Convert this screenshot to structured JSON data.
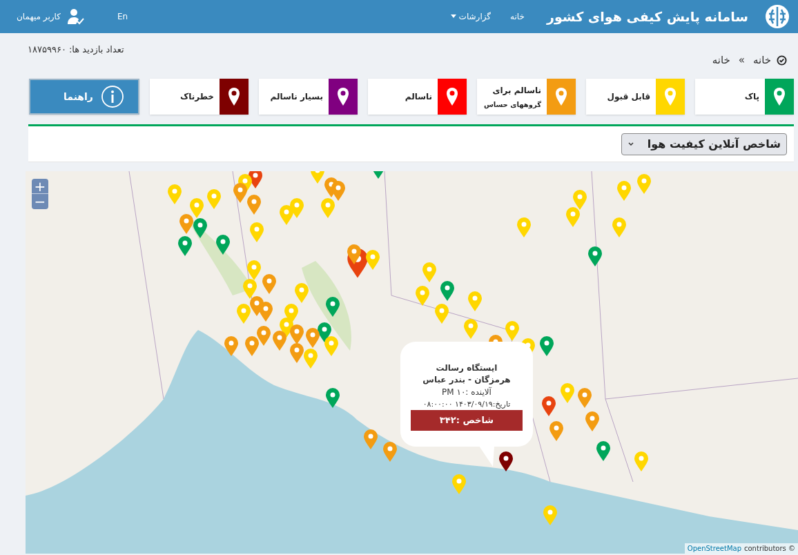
{
  "header": {
    "title": "سامانه پایش کیفی هوای کشور",
    "nav": [
      {
        "label": "خانه",
        "dropdown": false
      },
      {
        "label": "گزارشات",
        "dropdown": true
      }
    ],
    "language": "En",
    "user": "کاربر میهمان"
  },
  "visits": "تعداد بازدید ها: ۱۸۷۵۹۹۶۰",
  "breadcrumb": {
    "items": [
      "خانه",
      "خانه"
    ],
    "separator": "»"
  },
  "legend": [
    {
      "label": "پاک",
      "color": "#00a65a"
    },
    {
      "label": "قابل قبول",
      "color": "#ffd700"
    },
    {
      "label": "ناسالم برای",
      "sublabel": "گروههای حساس",
      "color": "#f39c12"
    },
    {
      "label": "ناسالم",
      "color": "#ff0000"
    },
    {
      "label": "بسیار ناسالم",
      "color": "#800080"
    },
    {
      "label": "خطرناک",
      "color": "#7e0000"
    }
  ],
  "help_button": "راهنما",
  "index_select": {
    "value": "شاخص آنلاین کیفیت هوا"
  },
  "map": {
    "zoom_in": "+",
    "zoom_out": "−",
    "popup": {
      "station": "ایستگاه رسالت",
      "location": "هرمزگان - بندر عباس",
      "pollutant": "آلاینده :PM ۱۰",
      "date": "تاریخ:۱۴۰۳/۰۹/۱۹ ۰۸:۰۰:۰۰",
      "index": "شاخص :۳۴۲"
    },
    "attribution": {
      "link": "OpenStreetMap",
      "text": "contributors ©"
    },
    "markers": [
      {
        "color": "#e8430f"
      },
      {
        "color": "#ffd700"
      },
      {
        "color": "#ffd700"
      },
      {
        "color": "#ffd700"
      },
      {
        "color": "#ffd700"
      },
      {
        "color": "#f39c12"
      },
      {
        "color": "#f39c12"
      },
      {
        "color": "#f39c12"
      },
      {
        "color": "#00a65a"
      },
      {
        "color": "#00a65a"
      },
      {
        "color": "#00a65a"
      },
      {
        "color": "#ffd700"
      },
      {
        "color": "#ffd700"
      },
      {
        "color": "#ffd700"
      },
      {
        "color": "#ffd700"
      },
      {
        "color": "#f39c12"
      },
      {
        "color": "#f39c12"
      },
      {
        "color": "#ffd700"
      },
      {
        "color": "#e8430f"
      },
      {
        "color": "#ffd700"
      },
      {
        "color": "#f39c12"
      },
      {
        "color": "#ffd700"
      },
      {
        "color": "#ffd700"
      },
      {
        "color": "#f39c12"
      },
      {
        "color": "#ffd700"
      },
      {
        "color": "#f39c12"
      },
      {
        "color": "#f39c12"
      },
      {
        "color": "#ffd700"
      },
      {
        "color": "#ffd700"
      },
      {
        "color": "#ffd700"
      },
      {
        "color": "#00a65a"
      },
      {
        "color": "#00a65a"
      },
      {
        "color": "#f39c12"
      },
      {
        "color": "#f39c12"
      },
      {
        "color": "#f39c12"
      },
      {
        "color": "#f39c12"
      },
      {
        "color": "#f39c12"
      },
      {
        "color": "#f39c12"
      },
      {
        "color": "#ffd700"
      },
      {
        "color": "#ffd700"
      },
      {
        "color": "#f39c12"
      },
      {
        "color": "#ffd700"
      },
      {
        "color": "#ffd700"
      },
      {
        "color": "#00a65a"
      },
      {
        "color": "#ffd700"
      },
      {
        "color": "#ffd700"
      },
      {
        "color": "#ffd700"
      },
      {
        "color": "#ffd700"
      },
      {
        "color": "#f39c12"
      },
      {
        "color": "#ffd700"
      },
      {
        "color": "#00a65a"
      },
      {
        "color": "#00a65a"
      },
      {
        "color": "#00a65a"
      },
      {
        "color": "#f39c12"
      },
      {
        "color": "#f39c12"
      },
      {
        "color": "#ffd700"
      },
      {
        "color": "#ffd700"
      },
      {
        "color": "#ffd700"
      },
      {
        "color": "#f39c12"
      },
      {
        "color": "#f39c12"
      },
      {
        "color": "#e8430f"
      },
      {
        "color": "#f39c12"
      },
      {
        "color": "#00a65a"
      },
      {
        "color": "#ffd700"
      },
      {
        "color": "#00a65a"
      },
      {
        "color": "#ffd700"
      },
      {
        "color": "#ffd700"
      },
      {
        "color": "#ffd700"
      },
      {
        "color": "#ffd700"
      },
      {
        "color": "#ffd700"
      },
      {
        "color": "#ffd700"
      },
      {
        "color": "#7e0000"
      }
    ]
  }
}
